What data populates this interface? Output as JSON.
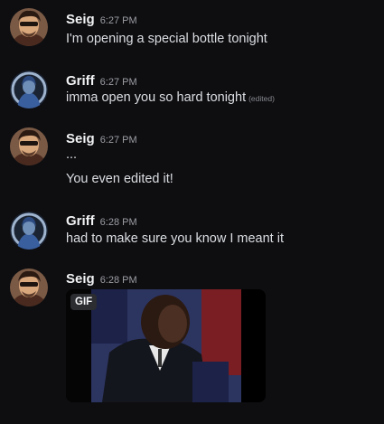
{
  "messages": [
    {
      "author": "Seig",
      "time": "6:27 PM",
      "lines": [
        "I'm opening a special bottle tonight"
      ]
    },
    {
      "author": "Griff",
      "time": "6:27 PM",
      "lines": [
        "imma open you so hard tonight"
      ],
      "edited": "(edited)"
    },
    {
      "author": "Seig",
      "time": "6:27 PM",
      "lines": [
        "...",
        "You even edited it!"
      ]
    },
    {
      "author": "Griff",
      "time": "6:28 PM",
      "lines": [
        "had to make sure you know I meant it"
      ]
    },
    {
      "author": "Seig",
      "time": "6:28 PM",
      "gif_label": "GIF"
    }
  ],
  "colors": {
    "background": "#0e0e11",
    "author_name": "#f2f3f5",
    "timestamp": "#9c9ea3",
    "message_text": "#dbdee1",
    "gif_tag_bg": "#2b2d31"
  },
  "icons": {
    "seig_avatar": "cartoon-man-avatar-icon",
    "griff_avatar": "blue-robed-figure-avatar-icon"
  }
}
